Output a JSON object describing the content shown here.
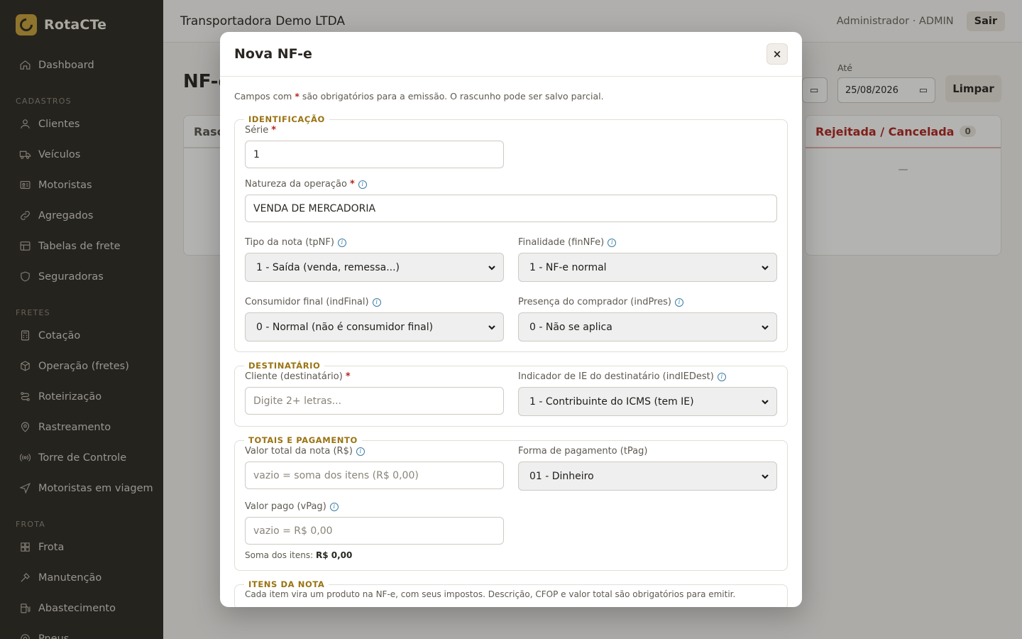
{
  "brand": {
    "name": "RotaCTe"
  },
  "sidebar": {
    "top": [
      {
        "label": "Dashboard",
        "icon": "home-icon"
      }
    ],
    "sections": [
      {
        "title": "CADASTROS",
        "items": [
          {
            "label": "Clientes",
            "icon": "user-icon"
          },
          {
            "label": "Veículos",
            "icon": "truck-icon"
          },
          {
            "label": "Motoristas",
            "icon": "id-card-icon"
          },
          {
            "label": "Agregados",
            "icon": "link-icon"
          },
          {
            "label": "Tabelas de frete",
            "icon": "table-icon"
          },
          {
            "label": "Seguradoras",
            "icon": "shield-icon"
          }
        ]
      },
      {
        "title": "FRETES",
        "items": [
          {
            "label": "Cotação",
            "icon": "calculator-icon"
          },
          {
            "label": "Operação (fretes)",
            "icon": "box-icon"
          },
          {
            "label": "Roteirização",
            "icon": "route-icon"
          },
          {
            "label": "Rastreamento",
            "icon": "map-pin-icon"
          },
          {
            "label": "Torre de Controle",
            "icon": "broadcast-icon"
          },
          {
            "label": "Motoristas em viagem",
            "icon": "navigation-icon"
          }
        ]
      },
      {
        "title": "FROTA",
        "items": [
          {
            "label": "Frota",
            "icon": "grid-icon"
          },
          {
            "label": "Manutenção",
            "icon": "wrench-icon"
          },
          {
            "label": "Abastecimento",
            "icon": "fuel-icon"
          },
          {
            "label": "Pneus",
            "icon": "tire-icon"
          }
        ]
      }
    ]
  },
  "topbar": {
    "company": "Transportadora Demo LTDA",
    "user": "Administrador · ADMIN",
    "logout": "Sair"
  },
  "page": {
    "title": "NF-e",
    "filter_to_label": "Até",
    "filter_to_value": "25/08/2026",
    "clear_label": "Limpar",
    "columns": [
      {
        "title": "Rasc"
      },
      {
        "title": "Rejeitada / Cancelada",
        "count": "0",
        "empty": "—"
      }
    ]
  },
  "modal": {
    "title": "Nova NF-e",
    "close": "×",
    "intro_pre": "Campos com ",
    "intro_star": "*",
    "intro_post": " são obrigatórios para a emissão. O rascunho pode ser salvo parcial.",
    "identificacao": {
      "legend": "IDENTIFICAÇÃO",
      "serie_label": "Série",
      "serie_value": "1",
      "natureza_label": "Natureza da operação",
      "natureza_value": "VENDA DE MERCADORIA",
      "tpnf_label": "Tipo da nota (tpNF)",
      "tpnf_value": "1 - Saída (venda, remessa...)",
      "finnfe_label": "Finalidade (finNFe)",
      "finnfe_value": "1 - NF-e normal",
      "indfinal_label": "Consumidor final (indFinal)",
      "indfinal_value": "0 - Normal (não é consumidor final)",
      "indpres_label": "Presença do comprador (indPres)",
      "indpres_value": "0 - Não se aplica"
    },
    "destinatario": {
      "legend": "DESTINATÁRIO",
      "cliente_label": "Cliente (destinatário)",
      "cliente_placeholder": "Digite 2+ letras...",
      "indiedest_label": "Indicador de IE do destinatário (indIEDest)",
      "indiedest_value": "1 - Contribuinte do ICMS (tem IE)"
    },
    "totais": {
      "legend": "TOTAIS E PAGAMENTO",
      "valor_total_label": "Valor total da nota (R$)",
      "valor_total_placeholder": "vazio = soma dos itens (R$ 0,00)",
      "tpag_label": "Forma de pagamento (tPag)",
      "tpag_value": "01 - Dinheiro",
      "vpag_label": "Valor pago (vPag)",
      "vpag_placeholder": "vazio = R$ 0,00",
      "soma_label": "Soma dos itens:",
      "soma_value": "R$ 0,00"
    },
    "itens": {
      "legend": "ITENS DA NOTA",
      "description": "Cada item vira um produto na NF-e, com seus impostos. Descrição, CFOP e valor total são obrigatórios para emitir."
    }
  }
}
